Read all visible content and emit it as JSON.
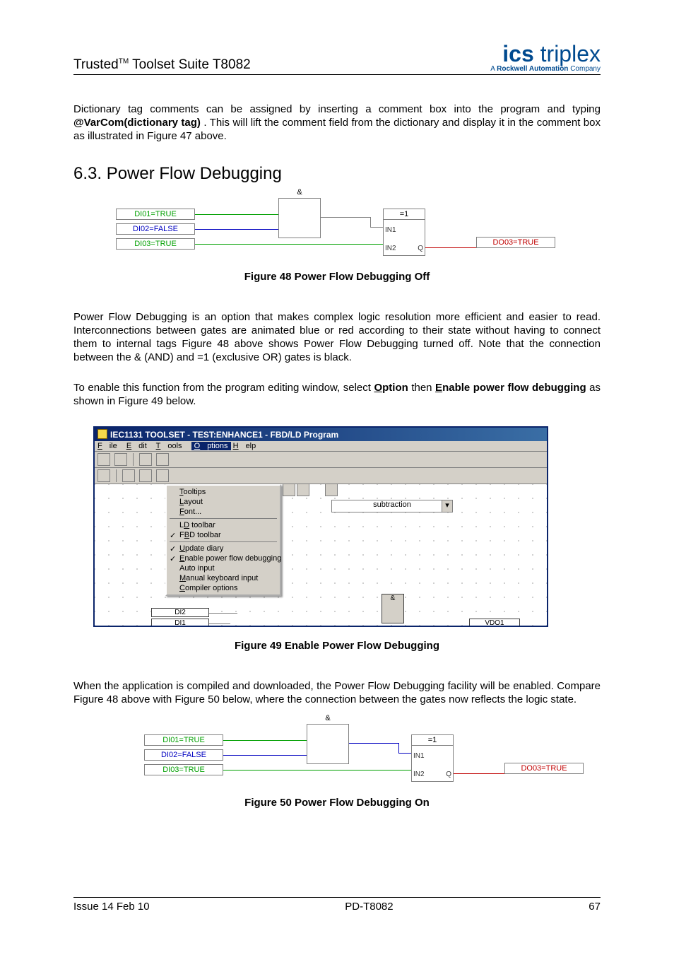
{
  "header": {
    "product_line": "Trusted",
    "tm": "TM",
    "product_suffix": " Toolset Suite T8082",
    "brand_primary": "ics",
    "brand_secondary": " triplex",
    "brand_tag_prefix": "A ",
    "brand_tag_bold": "Rockwell Automation",
    "brand_tag_suffix": " Company"
  },
  "para1": {
    "line1": "Dictionary tag comments can be assigned by inserting a comment box into the program and typing ",
    "bold": "@VarCom(dictionary tag)",
    "line2": " .  This will lift the comment field from the dictionary and display it in the comment box as illustrated in Figure 47 above."
  },
  "section": {
    "num": "6.3.",
    "title": " Power Flow Debugging"
  },
  "logic48": {
    "di01": "DI01=TRUE",
    "di02": "DI02=FALSE",
    "di03": "DI03=TRUE",
    "do03": "DO03=TRUE",
    "and_sym": "&",
    "xor_sym": "=1",
    "in1": "IN1",
    "in2": "IN2",
    "q": "Q"
  },
  "figcap48": "Figure 48 Power Flow Debugging Off",
  "para2": "Power Flow Debugging is an option that makes complex logic resolution more efficient and easier to read. Interconnections between gates are animated blue or red according to their state without having to connect them to internal tags Figure 48 above shows Power Flow Debugging turned off. Note that the connection between the & (AND) and =1 (exclusive OR) gates is black.",
  "para3": {
    "pre": "To enable this function from the program editing window, select ",
    "opt": "Option",
    "mid": " then ",
    "en": "Enable power flow debugging",
    "post": " as shown in Figure 49 below."
  },
  "appwin": {
    "title": "IEC1131 TOOLSET - TEST:ENHANCE1 - FBD/LD Program",
    "menus": [
      "File",
      "Edit",
      "Tools",
      "Options",
      "Help"
    ],
    "dropdown": [
      {
        "label": "Tooltips",
        "chk": false
      },
      {
        "label": "Layout",
        "chk": false
      },
      {
        "label": "Font...",
        "chk": false
      },
      {
        "sep": true
      },
      {
        "label": "LD toolbar",
        "chk": false
      },
      {
        "label": "FBD toolbar",
        "chk": true
      },
      {
        "sep": true
      },
      {
        "label": "Update diary",
        "chk": true
      },
      {
        "label": "Enable power flow debugging",
        "chk": true
      },
      {
        "label": "Auto input",
        "chk": false
      },
      {
        "label": "Manual keyboard input",
        "chk": false
      },
      {
        "label": "Compiler options",
        "chk": false
      }
    ],
    "combo": "subtraction",
    "fbd": {
      "and": "&",
      "di2": "DI2",
      "di1": "DI1",
      "vdo1": "VDO1"
    }
  },
  "figcap49": "Figure 49 Enable Power Flow Debugging",
  "para4": "When the  application is compiled and downloaded, the Power Flow Debugging facility will be enabled. Compare Figure 48 above with Figure 50 below, where the connection between the gates now reflects the logic state.",
  "figcap50": "Figure 50 Power Flow Debugging On",
  "footer": {
    "left": "Issue 14 Feb 10",
    "center": "PD-T8082",
    "right": "67"
  }
}
